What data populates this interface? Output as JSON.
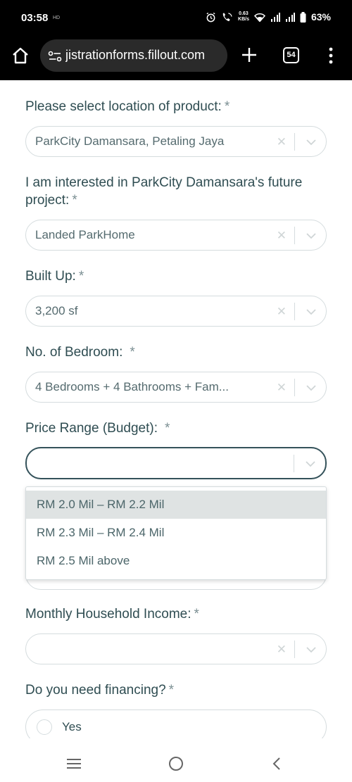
{
  "status": {
    "time": "03:58",
    "hd_badge": "HD",
    "speed_value": "0.63",
    "speed_unit": "KB/s",
    "battery": "63%"
  },
  "browser": {
    "url": "jistrationforms.fillout.com",
    "tab_count": "54"
  },
  "form": {
    "required_mark": "*",
    "location": {
      "label": "Please select location of product:",
      "value": "ParkCity Damansara, Petaling Jaya"
    },
    "interest": {
      "label": "I am interested in ParkCity Damansara's future project:",
      "value": "Landed ParkHome"
    },
    "built_up": {
      "label": "Built Up:",
      "value": "3,200 sf"
    },
    "bedroom": {
      "label": "No. of Bedroom:",
      "value": "4 Bedrooms + 4 Bathrooms + Fam..."
    },
    "price_range": {
      "label": "Price Range (Budget):",
      "value": "",
      "options": [
        "RM 2.0 Mil – RM 2.2 Mil",
        "RM 2.3 Mil – RM 2.4 Mil",
        "RM 2.5 Mil above"
      ]
    },
    "income": {
      "label": "Monthly Household Income:",
      "value": ""
    },
    "financing": {
      "label": "Do you need financing?",
      "options": [
        "Yes"
      ]
    }
  },
  "icons": {
    "clear": "close-icon",
    "chevron": "chevron-down-icon"
  },
  "colors": {
    "text": "#2f4d52",
    "border": "#d5dcde",
    "focus_border": "#34525a",
    "highlight": "#dfe3e3"
  }
}
